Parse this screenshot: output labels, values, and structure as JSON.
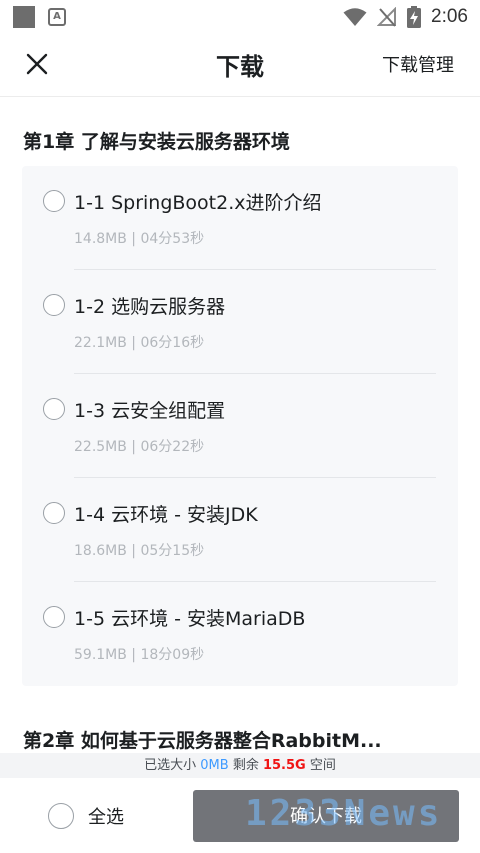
{
  "status_bar": {
    "app_icon_letter": "A",
    "time": "2:06"
  },
  "nav": {
    "title": "下载",
    "manage_label": "下载管理"
  },
  "chapters": [
    {
      "title": "第1章 了解与安装云服务器环境",
      "lessons": [
        {
          "title": "1-1 SpringBoot2.x进阶介绍",
          "meta": "14.8MB | 04分53秒"
        },
        {
          "title": "1-2 选购云服务器",
          "meta": "22.1MB | 06分16秒"
        },
        {
          "title": "1-3 云安全组配置",
          "meta": "22.5MB | 06分22秒"
        },
        {
          "title": "1-4 云环境 - 安装JDK",
          "meta": "18.6MB | 05分15秒"
        },
        {
          "title": "1-5 云环境 - 安装MariaDB",
          "meta": "59.1MB | 18分09秒"
        }
      ]
    },
    {
      "title": "第2章 如何基于云服务器整合RabbitM..."
    }
  ],
  "storage": {
    "prefix": "已选大小 ",
    "selected": "0MB",
    "middle": " 剩余 ",
    "remaining": "15.5G",
    "suffix": " 空间"
  },
  "bottom": {
    "select_all_label": "全选",
    "confirm_label": "确认下载",
    "watermark_text": "1233News"
  },
  "colors": {
    "selected_size": "#3f9bff",
    "remaining_space": "#f01414",
    "confirm_button": "#727479"
  }
}
